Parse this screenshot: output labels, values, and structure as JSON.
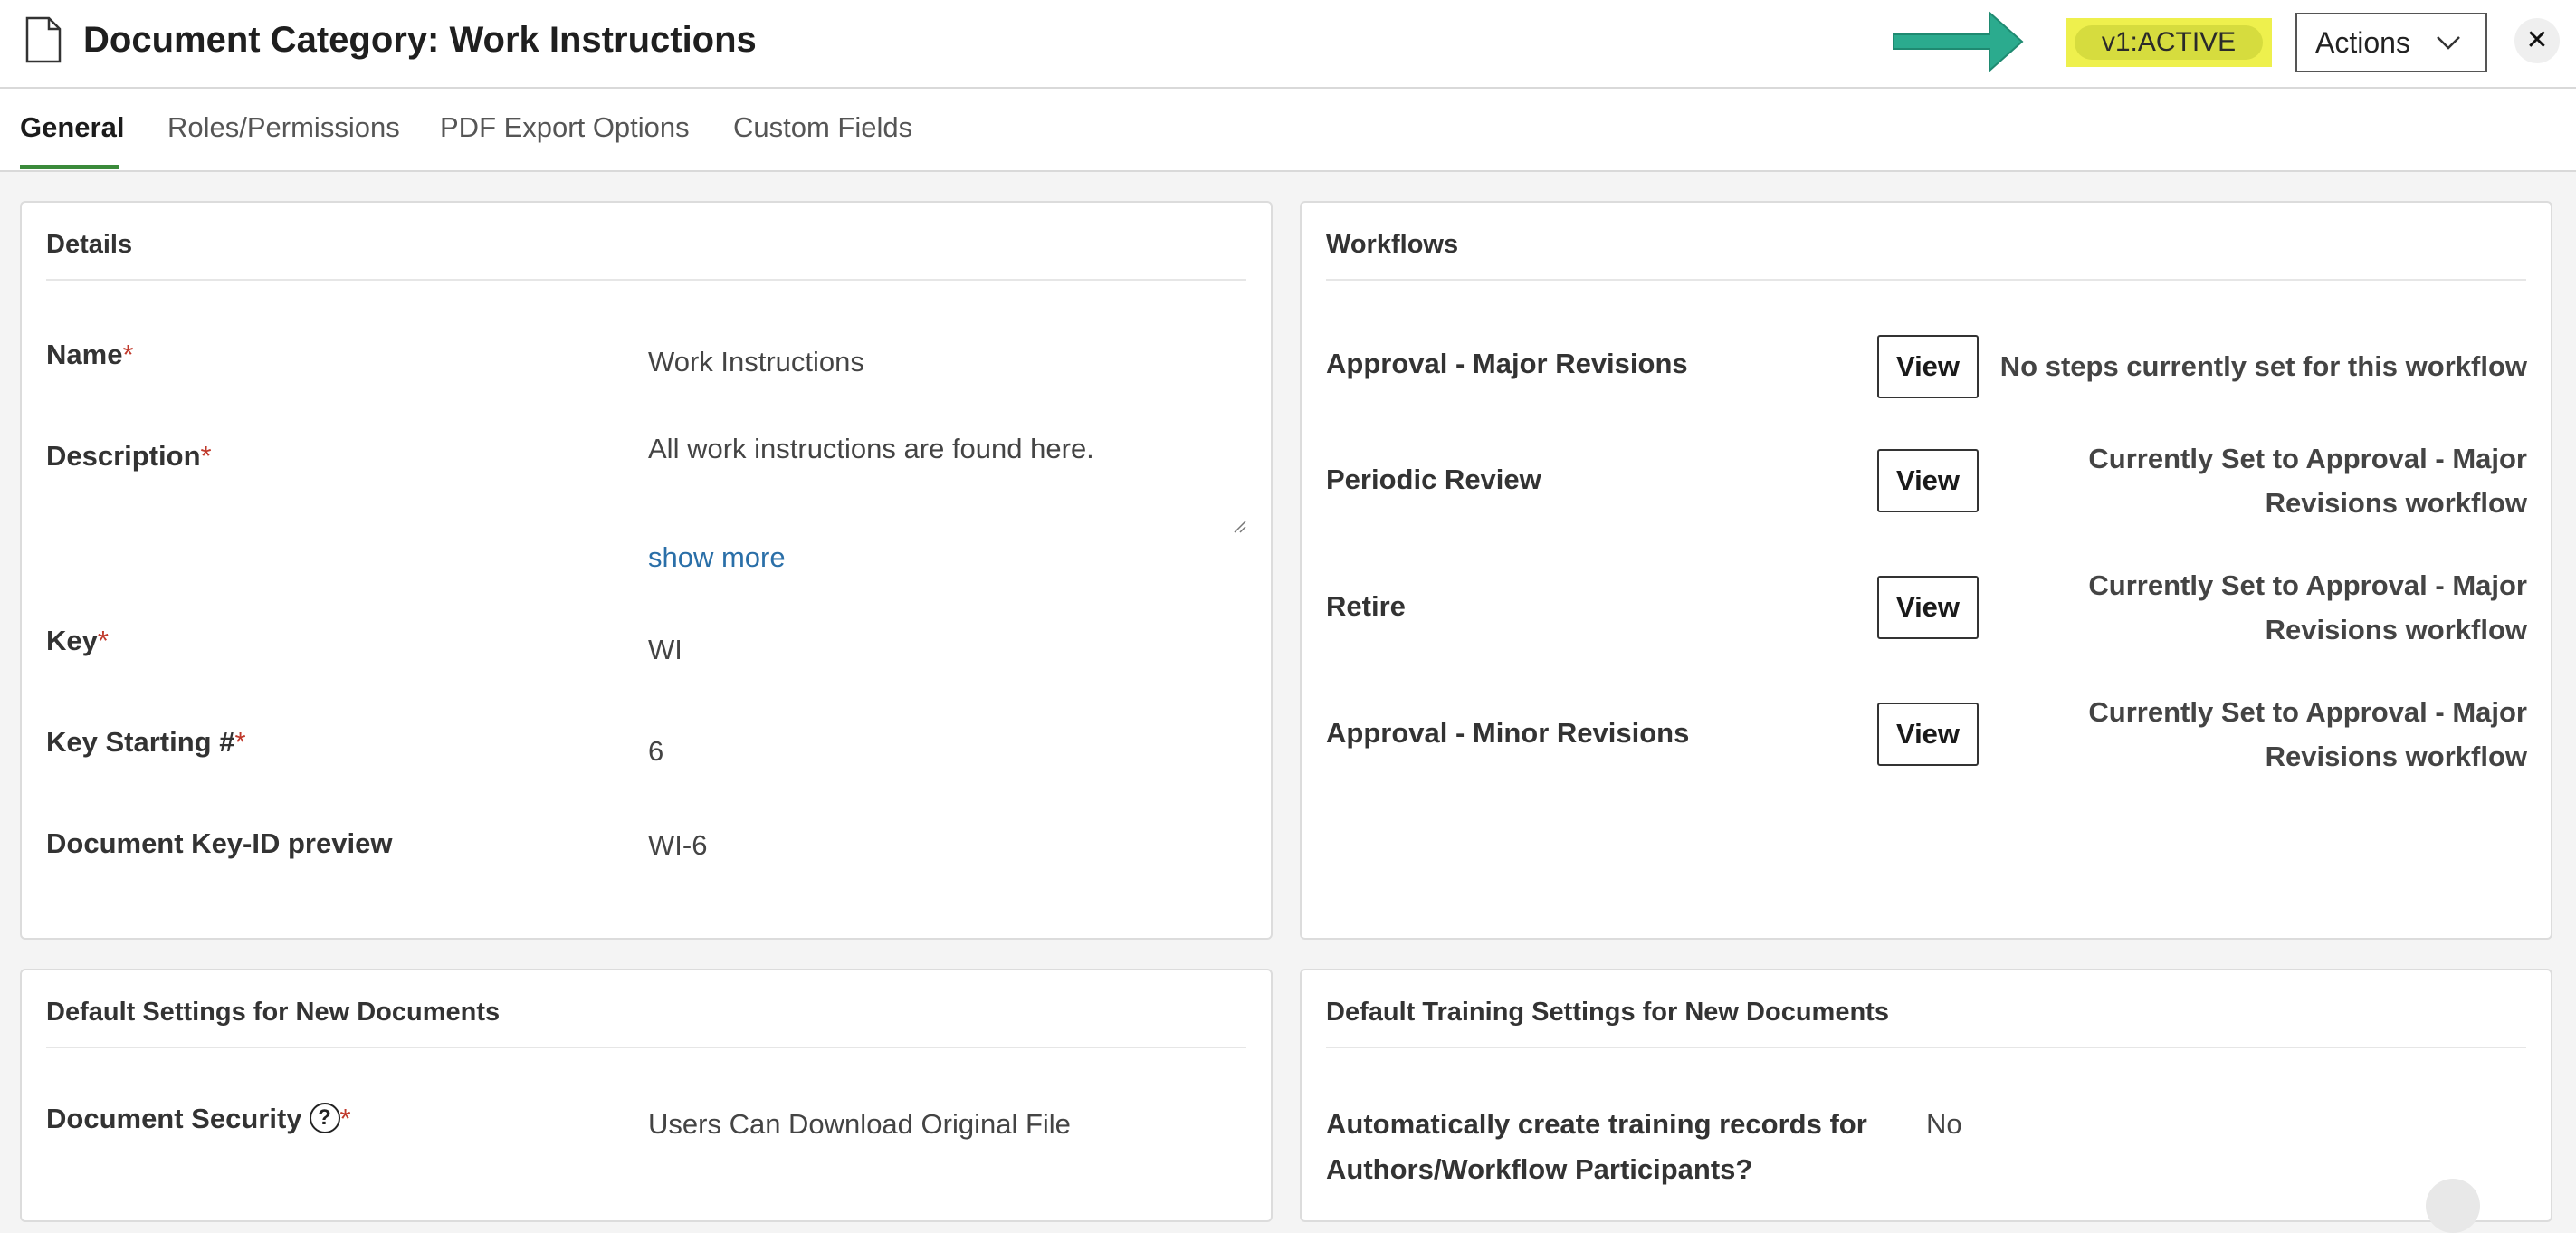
{
  "header": {
    "title": "Document Category: Work Instructions",
    "status": "v1:ACTIVE",
    "actions_label": "Actions",
    "close_glyph": "✕",
    "icons": [
      "document-icon",
      "arrow-right-icon",
      "chevron-down-icon",
      "close-icon"
    ],
    "colors": {
      "arrow": "#2bab8e",
      "highlight": "#eef04d",
      "active_tab": "#3a8a3a"
    }
  },
  "tabs": [
    {
      "label": "General",
      "active": true
    },
    {
      "label": "Roles/Permissions",
      "active": false
    },
    {
      "label": "PDF Export Options",
      "active": false
    },
    {
      "label": "Custom Fields",
      "active": false
    }
  ],
  "details": {
    "title": "Details",
    "name_label": "Name",
    "name_value": "Work Instructions",
    "description_label": "Description",
    "description_value": "All work instructions are found here.",
    "show_more": "show more",
    "key_label": "Key",
    "key_value": "WI",
    "key_start_label": "Key Starting #",
    "key_start_value": "6",
    "preview_label": "Document Key-ID preview",
    "preview_value": "WI-6",
    "required_mark": "*"
  },
  "workflows": {
    "title": "Workflows",
    "view_label": "View",
    "items": [
      {
        "name": "Approval - Major Revisions",
        "status": "No steps currently set for this workflow"
      },
      {
        "name": "Periodic Review",
        "status": "Currently Set to Approval - Major Revisions workflow"
      },
      {
        "name": "Retire",
        "status": "Currently Set to Approval - Major Revisions workflow"
      },
      {
        "name": "Approval - Minor Revisions",
        "status": "Currently Set to Approval - Major Revisions workflow"
      }
    ]
  },
  "default_settings": {
    "title": "Default Settings for New Documents",
    "security_label": "Document Security",
    "help_glyph": "?",
    "security_value": "Users Can Download Original File"
  },
  "training": {
    "title": "Default Training Settings for New Documents",
    "auto_label_line1": "Automatically create training records for",
    "auto_label_line2": "Authors/Workflow Participants?",
    "auto_value": "No"
  }
}
